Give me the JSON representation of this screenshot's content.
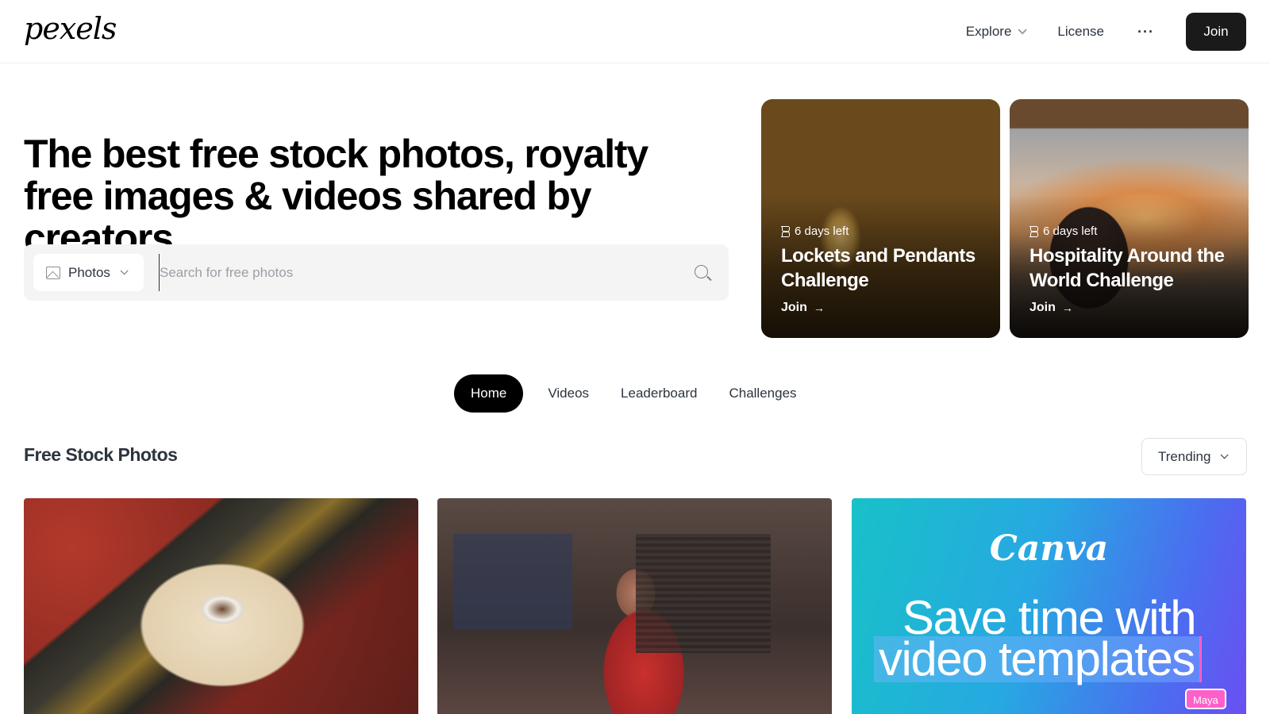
{
  "header": {
    "logo": "pexels",
    "nav": {
      "explore": "Explore",
      "license": "License",
      "more": "···",
      "join": "Join"
    }
  },
  "hero": {
    "title": "The best free stock photos, royalty free images & videos shared by creators.",
    "search": {
      "type_label": "Photos",
      "placeholder": "Search for free photos",
      "value": ""
    }
  },
  "challenges": [
    {
      "days_left": "6 days left",
      "title": "Lockets and Pendants Challenge",
      "join": "Join"
    },
    {
      "days_left": "6 days left",
      "title": "Hospitality Around the World Challenge",
      "join": "Join"
    }
  ],
  "tabs": [
    {
      "label": "Home",
      "active": true
    },
    {
      "label": "Videos",
      "active": false
    },
    {
      "label": "Leaderboard",
      "active": false
    },
    {
      "label": "Challenges",
      "active": false
    }
  ],
  "section": {
    "title": "Free Stock Photos",
    "sort": "Trending"
  },
  "ad": {
    "brand": "Canva",
    "line1": "Save time with",
    "line2": "video templates",
    "badge": "Maya"
  },
  "icons": {
    "search": "search-icon",
    "image": "image-icon",
    "hourglass": "hourglass-icon",
    "arrow": "arrow-right-icon",
    "chevron": "chevron-down-icon"
  },
  "colors": {
    "primary_dark": "#000000",
    "join_button": "#1a1a1a",
    "text": "#2c343e",
    "search_bg": "#f4f4f4"
  }
}
